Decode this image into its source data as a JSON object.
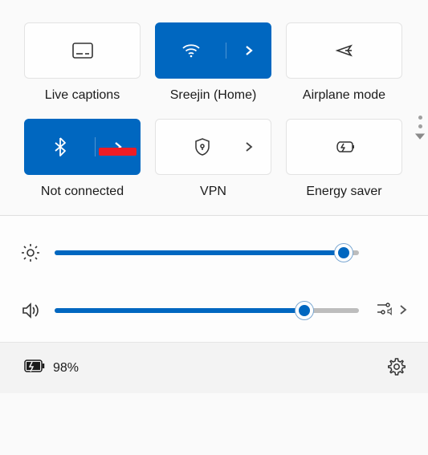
{
  "tiles": [
    {
      "label": "Live captions"
    },
    {
      "label": "Sreejin (Home)"
    },
    {
      "label": "Airplane mode"
    },
    {
      "label": "Not connected"
    },
    {
      "label": "VPN"
    },
    {
      "label": "Energy saver"
    }
  ],
  "sliders": {
    "brightness": {
      "percent": 95
    },
    "volume": {
      "percent": 82
    }
  },
  "battery": {
    "text": "98%"
  },
  "colors": {
    "accent": "#0067c0",
    "highlight_box": "#ee1c25"
  }
}
